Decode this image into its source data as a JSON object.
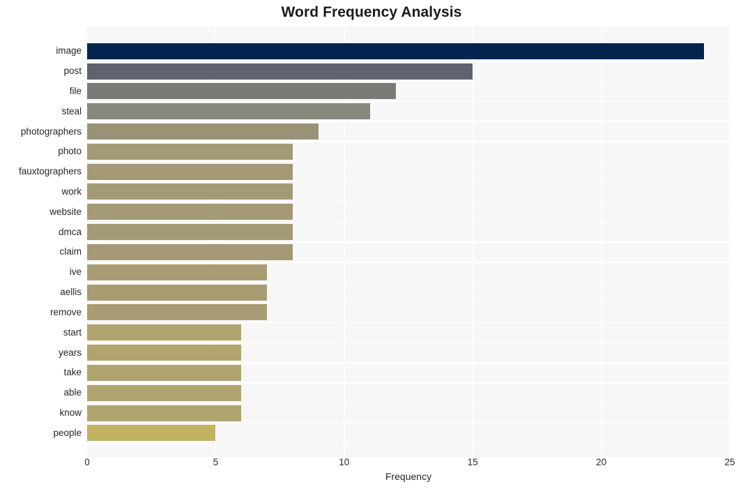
{
  "chart_data": {
    "type": "bar",
    "orientation": "horizontal",
    "title": "Word Frequency Analysis",
    "xlabel": "Frequency",
    "ylabel": "",
    "xlim": [
      0,
      25
    ],
    "xticks": [
      0,
      5,
      10,
      15,
      20,
      25
    ],
    "xtick_labels": [
      "0",
      "5",
      "10",
      "15",
      "20",
      "25"
    ],
    "grid": true,
    "legend": null,
    "plot_background": "#f7f7f7",
    "grid_color": "#ffffff",
    "categories": [
      "image",
      "post",
      "file",
      "steal",
      "photographers",
      "photo",
      "fauxtographers",
      "work",
      "website",
      "dmca",
      "claim",
      "ive",
      "aellis",
      "remove",
      "start",
      "years",
      "take",
      "able",
      "know",
      "people"
    ],
    "values": [
      24,
      15,
      12,
      11,
      9,
      8,
      8,
      8,
      8,
      8,
      8,
      7,
      7,
      7,
      6,
      6,
      6,
      6,
      6,
      5
    ],
    "bar_colors": [
      "#04234f",
      "#5f626f",
      "#7b7a77",
      "#88887b",
      "#9a9276",
      "#a39974",
      "#a39974",
      "#a39974",
      "#a39974",
      "#a39974",
      "#a39974",
      "#a89d72",
      "#a89d72",
      "#a89d72",
      "#b0a46e",
      "#b0a46e",
      "#b0a46e",
      "#b0a46e",
      "#b0a46e",
      "#c2b263"
    ]
  }
}
